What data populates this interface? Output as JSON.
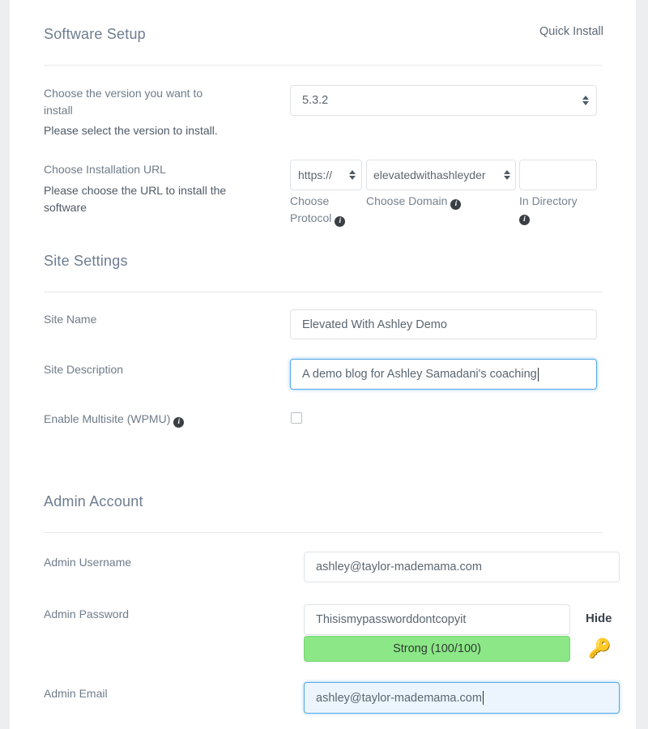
{
  "header": {
    "title": "Software Setup",
    "quick_install": "Quick Install"
  },
  "software_setup": {
    "version": {
      "label_line1": "Choose the version you want to",
      "label_line2": "install",
      "help": "Please select the version to install.",
      "value": "5.3.2"
    },
    "install_url": {
      "label": "Choose Installation URL",
      "help_line1": "Please choose the URL to install the",
      "help_line2": "software",
      "protocol_value": "https://",
      "protocol_caption_line1": "Choose",
      "protocol_caption_line2": "Protocol",
      "domain_value": "elevatedwithashleyder",
      "domain_caption": "Choose Domain",
      "directory_value": "",
      "directory_caption": "In Directory"
    }
  },
  "site_settings": {
    "heading": "Site Settings",
    "site_name": {
      "label": "Site Name",
      "value": "Elevated With Ashley Demo"
    },
    "site_description": {
      "label": "Site Description",
      "value": "A demo blog for Ashley Samadani's coaching"
    },
    "multisite": {
      "label": "Enable Multisite (WPMU)",
      "checked": false
    }
  },
  "admin_account": {
    "heading": "Admin Account",
    "username": {
      "label": "Admin Username",
      "value": "ashley@taylor-mademama.com"
    },
    "password": {
      "label": "Admin Password",
      "value": "Thisismypassworddontcopyit",
      "toggle_label": "Hide",
      "strength_text": "Strong (100/100)",
      "strength_color": "#8ce887",
      "generate_icon": "🔑"
    },
    "email": {
      "label": "Admin Email",
      "value": "ashley@taylor-mademama.com"
    }
  },
  "colors": {
    "heading": "#6e7d8f",
    "label": "#6f7c8a",
    "border": "#dfe3e6",
    "focus": "#54a9e8",
    "strength_green": "#8ce887"
  }
}
